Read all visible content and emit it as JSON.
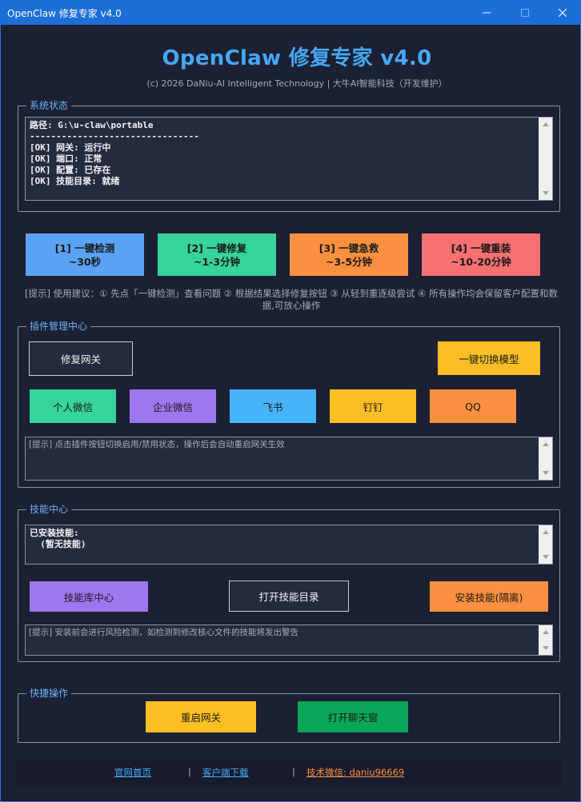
{
  "window": {
    "title": "OpenClaw 修复专家 v4.0",
    "controls": [
      "minimize-icon",
      "maximize-icon",
      "close-icon"
    ]
  },
  "header": {
    "title": "OpenClaw 修复专家 v4.0",
    "subtitle": "(c) 2026 DaNiu-AI Intelligent Technology | 大牛AI智能科技（开发维护）"
  },
  "system_status": {
    "label": "系统状态",
    "log": "路径: G:\\u-claw\\portable\n--------------------------------\n[OK] 网关: 运行中\n[OK] 端口: 正常\n[OK] 配置: 已存在\n[OK] 技能目录: 就绪"
  },
  "actions": [
    {
      "label": "[1] 一键检测",
      "time": "~30秒",
      "color": "#5ba2f4"
    },
    {
      "label": "[2] 一键修复",
      "time": "~1-3分钟",
      "color": "#36d39a"
    },
    {
      "label": "[3] 一键急救",
      "time": "~3-5分钟",
      "color": "#fb9040"
    },
    {
      "label": "[4] 一键重装",
      "time": "~10-20分钟",
      "color": "#f77173"
    }
  ],
  "tip": "[提示] 使用建议：① 先点「一键检测」查看问题 ② 根据结果选择修复按钮 ③ 从轻到重逐级尝试 ④ 所有操作均会保留客户配置和数据,可放心操作",
  "plugins": {
    "label": "插件管理中心",
    "repair_gateway": "修复网关",
    "switch_model": "一键切换模型",
    "items": [
      {
        "label": "个人微信",
        "color": "#36d39a"
      },
      {
        "label": "企业微信",
        "color": "#9d77ee"
      },
      {
        "label": "飞书",
        "color": "#46b4f8"
      },
      {
        "label": "钉钉",
        "color": "#fbbf24"
      },
      {
        "label": "QQ",
        "color": "#fb9040"
      }
    ],
    "hint": "[提示] 点击插件按钮切换启用/禁用状态，操作后会自动重启网关生效"
  },
  "skills": {
    "label": "技能中心",
    "installed": "已安装技能:\n  (暂无技能)",
    "library": "技能库中心",
    "open_dir": "打开技能目录",
    "install": "安装技能(隔离)",
    "hint": "[提示] 安装前会进行风险检测，如检测到修改核心文件的技能将发出警告"
  },
  "quick": {
    "label": "快捷操作",
    "restart": "重启网关",
    "chat": "打开聊天窗"
  },
  "footer": {
    "home": "官网首页",
    "download": "客户端下载",
    "wechat": "技术微信: daniu96669",
    "separator": "|"
  },
  "colors": {
    "background": "#1b2033",
    "accent": "#46a8f5",
    "titlebar": "#1d6fd8",
    "yellow": "#fbbf24",
    "green": "#0aa758",
    "orange": "#fb9040",
    "purple": "#9d77ee",
    "wechat_link": "#fb9040"
  }
}
